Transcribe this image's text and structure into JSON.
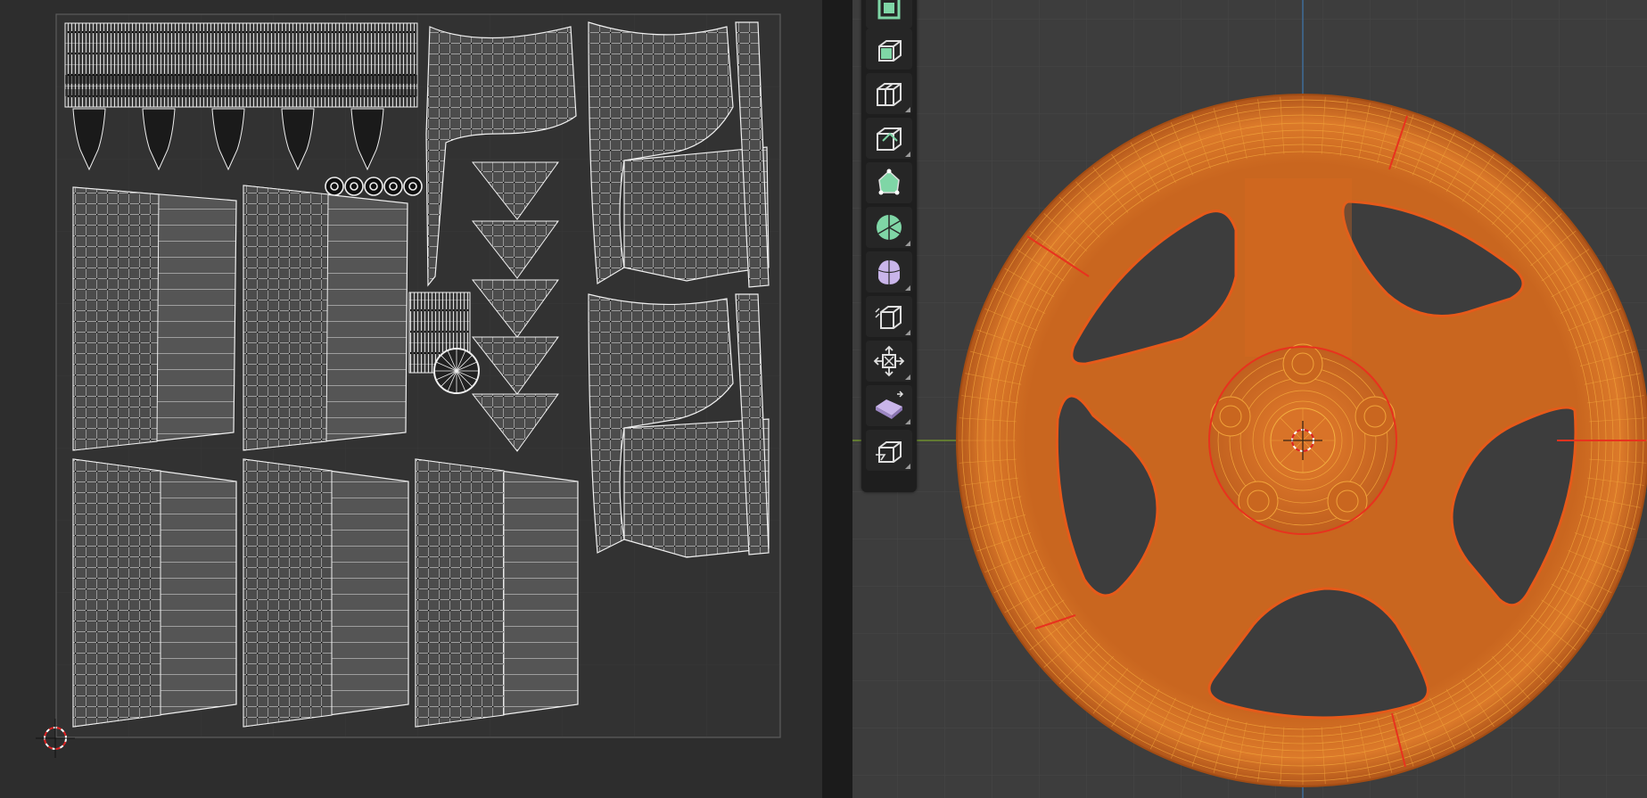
{
  "uv_editor": {
    "background": "#2d2d2d",
    "grid_color": "#3a3a3a",
    "border_color": "#5a5a5a",
    "island_edge_color": "#e8e8e8",
    "vertex_color": "#000000",
    "cursor_icon": "2d-cursor-icon"
  },
  "viewport": {
    "background": "#3d3d3d",
    "axis_x_color": "#6e8f2e",
    "axis_y_color": "#3f6f9f",
    "mesh_fill": "#d96a1f",
    "mesh_wire": "#f0a23a",
    "seam_color": "#e8321e",
    "cursor_icon": "3d-cursor-icon"
  },
  "toolbar": {
    "accent_green": "#7fd6a6",
    "accent_purple": "#c9b5ea",
    "tools": [
      {
        "name": "select-box-tool",
        "icon": "select-box-icon",
        "accent": "green"
      },
      {
        "name": "extrude-region-tool",
        "icon": "extrude-region-icon",
        "accent": "green"
      },
      {
        "name": "loop-cut-tool",
        "icon": "loop-cut-icon",
        "accent": "white",
        "has_submenu": true
      },
      {
        "name": "knife-tool",
        "icon": "knife-icon",
        "accent": "white",
        "has_submenu": true
      },
      {
        "name": "poly-build-tool",
        "icon": "poly-build-icon",
        "accent": "green"
      },
      {
        "name": "spin-tool",
        "icon": "spin-icon",
        "accent": "green",
        "has_submenu": true
      },
      {
        "name": "smooth-tool",
        "icon": "smooth-vertices-icon",
        "accent": "purple",
        "has_submenu": true
      },
      {
        "name": "edge-slide-tool",
        "icon": "edge-slide-icon",
        "accent": "white",
        "has_submenu": true
      },
      {
        "name": "shrink-fatten-tool",
        "icon": "shrink-fatten-icon",
        "accent": "white",
        "has_submenu": true
      },
      {
        "name": "shear-tool",
        "icon": "shear-icon",
        "accent": "purple",
        "has_submenu": true
      },
      {
        "name": "rip-region-tool",
        "icon": "rip-region-icon",
        "accent": "white",
        "has_submenu": true
      }
    ]
  }
}
